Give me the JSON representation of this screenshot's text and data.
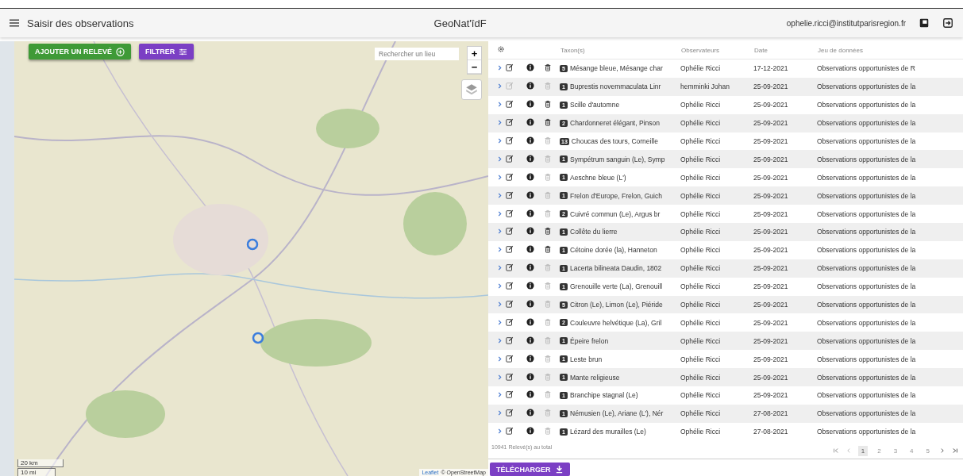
{
  "header": {
    "title": "Saisir des observations",
    "app_name": "GeoNat'îdF",
    "user_email": "ophelie.ricci@institutparisregion.fr"
  },
  "map": {
    "add_button": "AJOUTER UN RELEVÉ",
    "filter_button": "FILTRER",
    "search": {
      "placeholder": "Rechercher un lieu"
    },
    "zoom_in": "+",
    "zoom_out": "−",
    "scale": [
      "20 km",
      "10 mi"
    ],
    "attribution": [
      "Leaflet",
      "© OpenStreetMap"
    ]
  },
  "table": {
    "columns": [
      "Taxon(s)",
      "Observateurs",
      "Date",
      "Jeu de données"
    ],
    "rows": [
      {
        "count": "5",
        "taxon": "Mésange bleue, Mésange char",
        "observer": "Ophélie Ricci",
        "date": "17-12-2021",
        "dataset": "Observations opportunistes de R",
        "edit_disabled": false,
        "delete_disabled": false
      },
      {
        "count": "1",
        "taxon": "Buprestis novemmaculata Linr",
        "observer": "hemminki Johan",
        "date": "25-09-2021",
        "dataset": "Observations opportunistes de la",
        "edit_disabled": true,
        "delete_disabled": true
      },
      {
        "count": "1",
        "taxon": "Scille d'automne",
        "observer": "Ophélie Ricci",
        "date": "25-09-2021",
        "dataset": "Observations opportunistes de la",
        "edit_disabled": false,
        "delete_disabled": false
      },
      {
        "count": "2",
        "taxon": "Chardonneret élégant, Pinson",
        "observer": "Ophélie Ricci",
        "date": "25-09-2021",
        "dataset": "Observations opportunistes de la",
        "edit_disabled": false,
        "delete_disabled": false
      },
      {
        "count": "13",
        "taxon": "Choucas des tours, Corneille",
        "observer": "Ophélie Ricci",
        "date": "25-09-2021",
        "dataset": "Observations opportunistes de la",
        "edit_disabled": false,
        "delete_disabled": true
      },
      {
        "count": "1",
        "taxon": "Sympétrum sanguin (Le), Symp",
        "observer": "Ophélie Ricci",
        "date": "25-09-2021",
        "dataset": "Observations opportunistes de la",
        "edit_disabled": false,
        "delete_disabled": true
      },
      {
        "count": "1",
        "taxon": "Aeschne bleue (L')",
        "observer": "Ophélie Ricci",
        "date": "25-09-2021",
        "dataset": "Observations opportunistes de la",
        "edit_disabled": false,
        "delete_disabled": true
      },
      {
        "count": "1",
        "taxon": "Frelon d'Europe, Frelon, Guich",
        "observer": "Ophélie Ricci",
        "date": "25-09-2021",
        "dataset": "Observations opportunistes de la",
        "edit_disabled": false,
        "delete_disabled": true
      },
      {
        "count": "2",
        "taxon": "Cuivré commun (Le), Argus br",
        "observer": "Ophélie Ricci",
        "date": "25-09-2021",
        "dataset": "Observations opportunistes de la",
        "edit_disabled": false,
        "delete_disabled": true
      },
      {
        "count": "1",
        "taxon": "Collête du lierre",
        "observer": "Ophélie Ricci",
        "date": "25-09-2021",
        "dataset": "Observations opportunistes de la",
        "edit_disabled": false,
        "delete_disabled": false
      },
      {
        "count": "1",
        "taxon": "Cétoine dorée (la), Hanneton",
        "observer": "Ophélie Ricci",
        "date": "25-09-2021",
        "dataset": "Observations opportunistes de la",
        "edit_disabled": false,
        "delete_disabled": false
      },
      {
        "count": "1",
        "taxon": "Lacerta bilineata Daudin, 1802",
        "observer": "Ophélie Ricci",
        "date": "25-09-2021",
        "dataset": "Observations opportunistes de la",
        "edit_disabled": false,
        "delete_disabled": true
      },
      {
        "count": "1",
        "taxon": "Grenouille verte (La), Grenouill",
        "observer": "Ophélie Ricci",
        "date": "25-09-2021",
        "dataset": "Observations opportunistes de la",
        "edit_disabled": false,
        "delete_disabled": true
      },
      {
        "count": "5",
        "taxon": "Citron (Le), Limon (Le), Piéride",
        "observer": "Ophélie Ricci",
        "date": "25-09-2021",
        "dataset": "Observations opportunistes de la",
        "edit_disabled": false,
        "delete_disabled": true
      },
      {
        "count": "2",
        "taxon": "Couleuvre helvétique (La), Gril",
        "observer": "Ophélie Ricci",
        "date": "25-09-2021",
        "dataset": "Observations opportunistes de la",
        "edit_disabled": false,
        "delete_disabled": true
      },
      {
        "count": "1",
        "taxon": "Épeire frelon",
        "observer": "Ophélie Ricci",
        "date": "25-09-2021",
        "dataset": "Observations opportunistes de la",
        "edit_disabled": false,
        "delete_disabled": true
      },
      {
        "count": "1",
        "taxon": "Leste brun",
        "observer": "Ophélie Ricci",
        "date": "25-09-2021",
        "dataset": "Observations opportunistes de la",
        "edit_disabled": false,
        "delete_disabled": true
      },
      {
        "count": "1",
        "taxon": "Mante religieuse",
        "observer": "Ophélie Ricci",
        "date": "25-09-2021",
        "dataset": "Observations opportunistes de la",
        "edit_disabled": false,
        "delete_disabled": true
      },
      {
        "count": "1",
        "taxon": "Branchipe stagnal (Le)",
        "observer": "Ophélie Ricci",
        "date": "25-09-2021",
        "dataset": "Observations opportunistes de la",
        "edit_disabled": false,
        "delete_disabled": true
      },
      {
        "count": "1",
        "taxon": "Némusien (Le), Ariane (L'), Nér",
        "observer": "Ophélie Ricci",
        "date": "27-08-2021",
        "dataset": "Observations opportunistes de la",
        "edit_disabled": false,
        "delete_disabled": true
      },
      {
        "count": "1",
        "taxon": "Lézard des murailles (Le)",
        "observer": "Ophélie Ricci",
        "date": "27-08-2021",
        "dataset": "Observations opportunistes de la",
        "edit_disabled": false,
        "delete_disabled": true
      }
    ],
    "total": "10941 Relevé(s) au total",
    "pages": [
      {
        "label": "1",
        "selected": true
      },
      {
        "label": "2",
        "selected": false
      },
      {
        "label": "3",
        "selected": false
      },
      {
        "label": "4",
        "selected": false
      },
      {
        "label": "5",
        "selected": false
      }
    ]
  },
  "download_button": "TÉLÉCHARGER"
}
